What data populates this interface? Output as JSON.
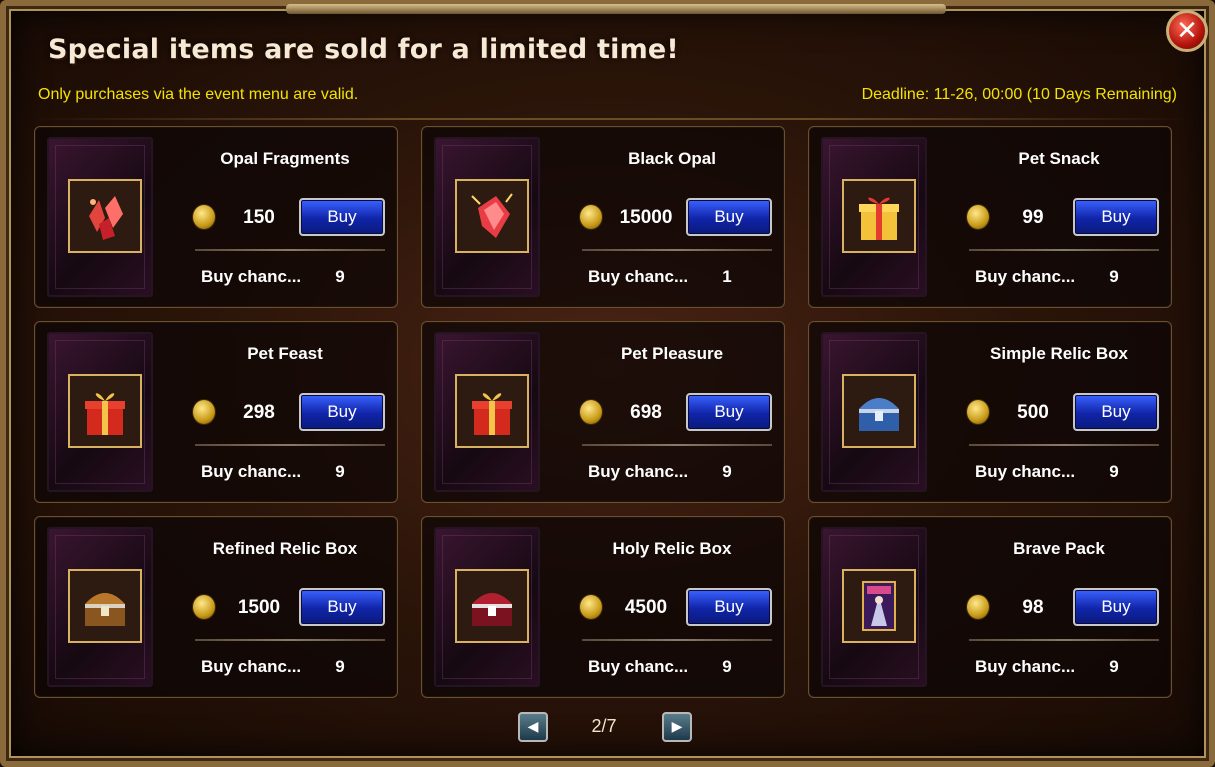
{
  "title": "Special items are sold for a limited time!",
  "subtitle": "Only purchases via the event menu are valid.",
  "deadline": "Deadline: 11-26, 00:00 (10 Days Remaining)",
  "close_icon": "close-icon",
  "buy_label": "Buy",
  "chance_label": "Buy chanc...",
  "items": [
    {
      "name": "Opal Fragments",
      "price": "150",
      "chance": "9",
      "icon": "opal-fragments-icon"
    },
    {
      "name": "Black Opal",
      "price": "15000",
      "chance": "1",
      "icon": "black-opal-icon"
    },
    {
      "name": "Pet Snack",
      "price": "99",
      "chance": "9",
      "icon": "gift-box-yellow-icon"
    },
    {
      "name": "Pet Feast",
      "price": "298",
      "chance": "9",
      "icon": "gift-box-red-icon"
    },
    {
      "name": "Pet Pleasure",
      "price": "698",
      "chance": "9",
      "icon": "gift-box-red-icon"
    },
    {
      "name": "Simple Relic Box",
      "price": "500",
      "chance": "9",
      "icon": "blue-chest-icon"
    },
    {
      "name": "Refined Relic Box",
      "price": "1500",
      "chance": "9",
      "icon": "gold-chest-icon"
    },
    {
      "name": "Holy Relic Box",
      "price": "4500",
      "chance": "9",
      "icon": "red-chest-icon"
    },
    {
      "name": "Brave Pack",
      "price": "98",
      "chance": "9",
      "icon": "character-card-icon"
    }
  ],
  "pagination": {
    "page": "2/7",
    "prev_icon": "prev-arrow-icon",
    "next_icon": "next-arrow-icon"
  },
  "colors": {
    "accent_text": "#f3e300",
    "buy_button": "#1a3ad0",
    "frame_gold": "#b0925a"
  }
}
